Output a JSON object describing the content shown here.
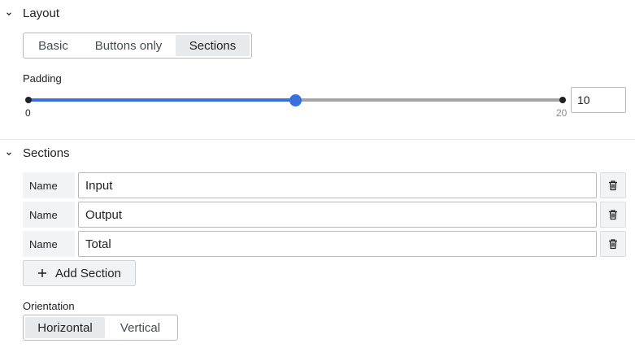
{
  "layout_section": {
    "title": "Layout",
    "options": [
      "Basic",
      "Buttons only",
      "Sections"
    ],
    "selected": "Sections"
  },
  "padding": {
    "label": "Padding",
    "min": "0",
    "max": "20",
    "value": "10",
    "fraction": 0.5
  },
  "sections_section": {
    "title": "Sections",
    "rows": [
      {
        "label": "Name",
        "value": "Input"
      },
      {
        "label": "Name",
        "value": "Output"
      },
      {
        "label": "Name",
        "value": "Total"
      }
    ],
    "add_label": "Add Section"
  },
  "orientation": {
    "label": "Orientation",
    "options": [
      "Horizontal",
      "Vertical"
    ],
    "selected": "Horizontal"
  },
  "colors": {
    "accent": "#3871dc",
    "track": "#a3a5a8",
    "text": "#202226"
  },
  "icons": {
    "collapse": "chevron-down-icon",
    "delete": "trash-icon",
    "add": "plus-icon"
  }
}
